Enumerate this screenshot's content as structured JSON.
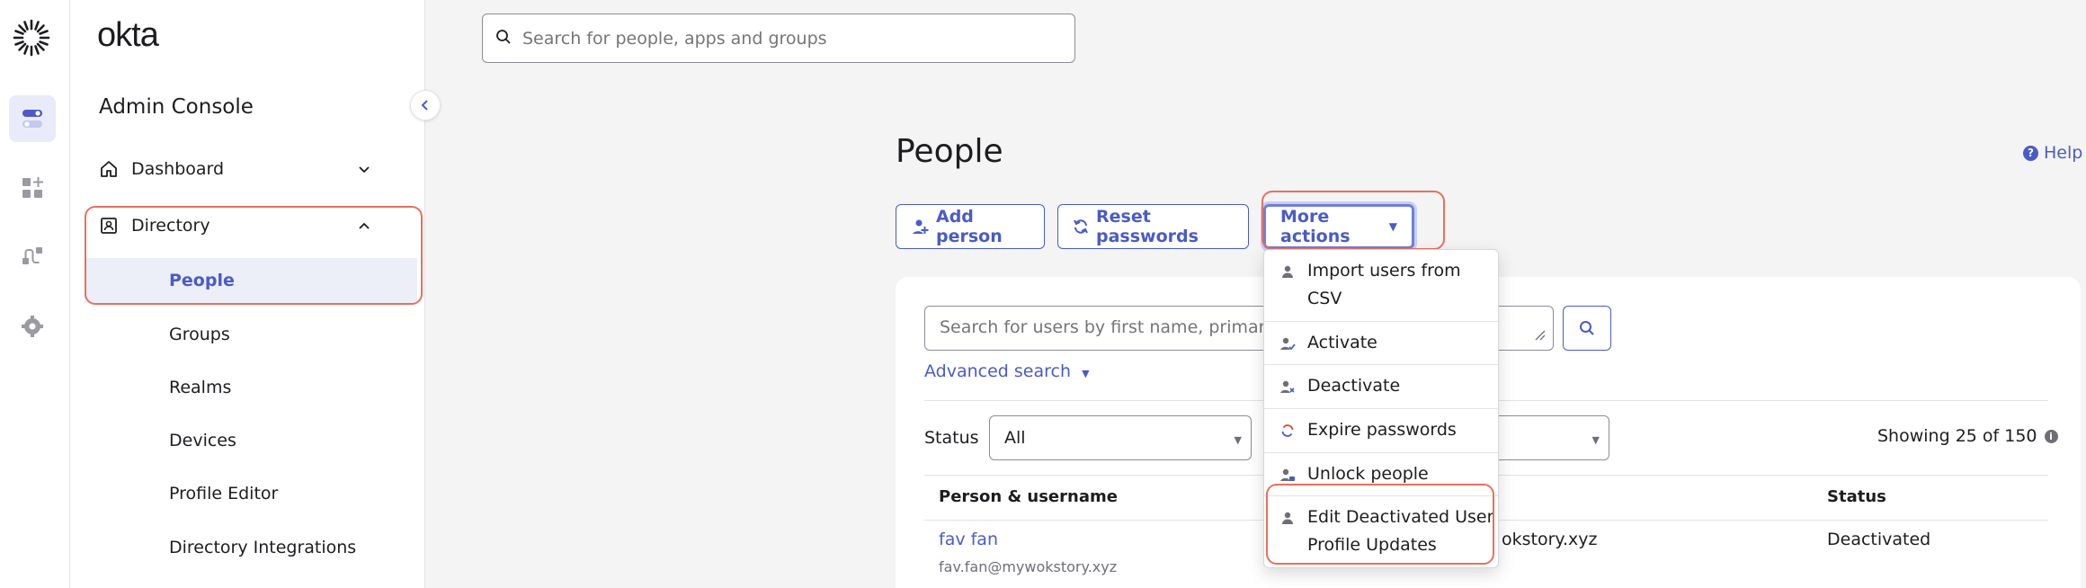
{
  "sidebar": {
    "brand": "okta",
    "console_title": "Admin Console",
    "nav": {
      "dashboard": "Dashboard",
      "directory": "Directory"
    },
    "directory_items": [
      "People",
      "Groups",
      "Realms",
      "Devices",
      "Profile Editor",
      "Directory Integrations"
    ]
  },
  "top_search": {
    "placeholder": "Search for people, apps and groups"
  },
  "page": {
    "title": "People",
    "help": "Help"
  },
  "toolbar": {
    "add_person": "Add person",
    "reset_passwords": "Reset passwords",
    "more_actions": "More actions"
  },
  "more_actions_menu": {
    "import_line1": "Import users from",
    "import_line2": "CSV",
    "activate": "Activate",
    "deactivate": "Deactivate",
    "expire_passwords": "Expire passwords",
    "unlock_people": "Unlock people",
    "edit_line1": "Edit Deactivated User",
    "edit_line2": "Profile Updates"
  },
  "filters": {
    "user_search_placeholder": "Search for users by first name, primary em",
    "advanced_search": "Advanced search",
    "status_label": "Status",
    "status_value": "All",
    "showing": "Showing 25 of 150"
  },
  "table": {
    "headers": {
      "person": "Person & username",
      "status": "Status"
    },
    "rows": [
      {
        "name": "fav fan",
        "username": "fav.fan@mywokstory.xyz",
        "email_partial": "okstory.xyz",
        "status": "Deactivated"
      }
    ]
  },
  "colors": {
    "accent": "#4a5bc6",
    "highlight": "#e8705f"
  }
}
